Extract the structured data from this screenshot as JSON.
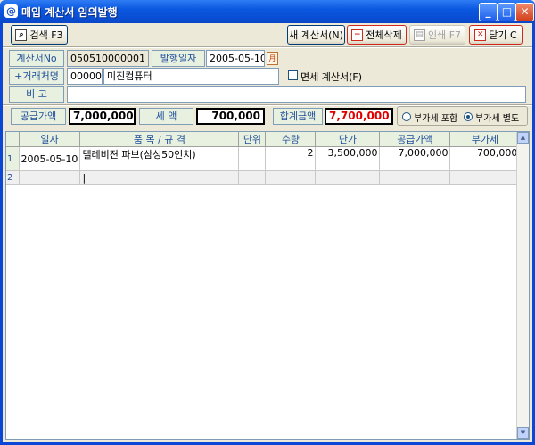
{
  "window": {
    "title": "매입 계산서 임의발행",
    "icon_glyph": "@"
  },
  "toolbar": {
    "search_label": "검색 F3",
    "new_invoice_label": "새 계산서(N)",
    "delete_all_label": "전체삭제",
    "print_label": "인쇄 F7",
    "close_label": "닫기 C"
  },
  "form": {
    "invoice_no_label": "계산서No",
    "invoice_no_value": "050510000001",
    "issue_date_label": "발행일자",
    "issue_date_value": "2005-05-10",
    "supplier_label": "+거래처명",
    "supplier_code": "000004",
    "supplier_name": "미진컴퓨터",
    "tax_exempt_label": "면세 계산서(F)",
    "tax_exempt_checked": false,
    "remarks_label": "비    고",
    "remarks_value": ""
  },
  "totals": {
    "supply_label": "공급가액",
    "supply_value": "7,000,000",
    "tax_label": "세    액",
    "tax_value": "700,000",
    "total_label": "합계금액",
    "total_value": "7,700,000",
    "vat_included_label": "부가세 포함",
    "vat_separate_label": "부가세 별도",
    "vat_mode": "separate"
  },
  "grid": {
    "columns": [
      "",
      "일자",
      "품 목 / 규 격",
      "단위",
      "수량",
      "단가",
      "공급가액",
      "부가세"
    ],
    "rows": [
      {
        "num": "1",
        "date": "2005-05-10",
        "item": "텔레비젼 파브(삼성50인치)",
        "unit": "",
        "qty": "2",
        "price": "3,500,000",
        "supply": "7,000,000",
        "vat": "700,000"
      },
      {
        "num": "2",
        "date": "",
        "item": "|",
        "unit": "",
        "qty": "",
        "price": "",
        "supply": "",
        "vat": ""
      }
    ]
  },
  "colors": {
    "title_bar": "#0a48c8",
    "label_bg": "#e8f0e0",
    "label_text": "#1f4e9a",
    "total_text": "#e00000"
  }
}
